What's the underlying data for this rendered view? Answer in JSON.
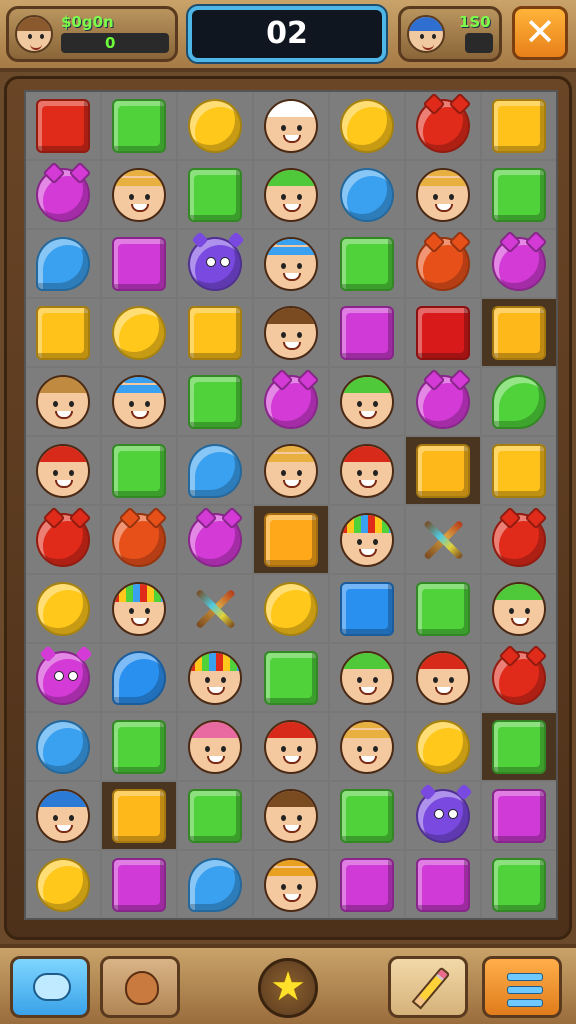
{
  "header": {
    "player1": {
      "label": "$0g0n",
      "score": "0"
    },
    "moves": "02",
    "player2": {
      "label": "1S0",
      "score": ""
    },
    "close_label": "✕"
  },
  "board": {
    "rows": [
      [
        [
          "square",
          "#e02a1a"
        ],
        [
          "square",
          "#4fd23a"
        ],
        [
          "circle",
          "#ffc81a"
        ],
        [
          "face",
          "#ffffff",
          "white-hair"
        ],
        [
          "circle",
          "#ffc81a"
        ],
        [
          "horned",
          "#e02a1a"
        ],
        [
          "square",
          "#ffc21a"
        ]
      ],
      [
        [
          "horned",
          "#d33ad6"
        ],
        [
          "face",
          "#e8b040",
          "straw-hat"
        ],
        [
          "square",
          "#4fd23a"
        ],
        [
          "face",
          "#4fc93a",
          "green-cap"
        ],
        [
          "circle",
          "#3aa0f0"
        ],
        [
          "face",
          "#e8b040",
          "straw-hat"
        ],
        [
          "square",
          "#4fd23a"
        ]
      ],
      [
        [
          "drop",
          "#3aa0f0"
        ],
        [
          "square",
          "#d03ad6"
        ],
        [
          "monster",
          "#7a4ae0"
        ],
        [
          "face",
          "#3aa0f0",
          "blue-hat"
        ],
        [
          "square",
          "#4fd23a"
        ],
        [
          "horned",
          "#e8501a"
        ],
        [
          "horned",
          "#d33ad6"
        ]
      ],
      [
        [
          "square",
          "#ffc21a"
        ],
        [
          "circle",
          "#ffc81a"
        ],
        [
          "square",
          "#ffc21a"
        ],
        [
          "face",
          "#7a4a20",
          "short-hair"
        ],
        [
          "square",
          "#d03ad6"
        ],
        [
          "square",
          "#d81a1a"
        ],
        [
          "square",
          "#ffb81a",
          "dark"
        ]
      ],
      [
        [
          "face",
          "#c08a40",
          "cap"
        ],
        [
          "face",
          "#3aa0f0",
          "blue-hat-bow"
        ],
        [
          "square",
          "#4fd23a"
        ],
        [
          "horned",
          "#d33ad6"
        ],
        [
          "face",
          "#4fc93a",
          "green-cap"
        ],
        [
          "horned",
          "#d33ad6"
        ],
        [
          "drop",
          "#4fd23a"
        ]
      ],
      [
        [
          "face",
          "#d82a1a",
          "red-cap"
        ],
        [
          "square",
          "#4fd23a"
        ],
        [
          "drop",
          "#3aa0f0"
        ],
        [
          "face",
          "#e8b040",
          "straw-hat"
        ],
        [
          "face",
          "#d82a1a",
          "red-cap"
        ],
        [
          "square",
          "#ffb81a",
          "dark"
        ],
        [
          "square",
          "#ffc21a"
        ]
      ],
      [
        [
          "horned",
          "#e02a1a"
        ],
        [
          "horned",
          "#e8501a"
        ],
        [
          "horned",
          "#d33ad6"
        ],
        [
          "square",
          "#ffa81a",
          "dark"
        ],
        [
          "face",
          "#e0c03a",
          "rainbow-hair"
        ],
        [
          "tools",
          "#b33a1a"
        ],
        [
          "horned",
          "#e02a1a"
        ]
      ],
      [
        [
          "circle",
          "#ffc81a"
        ],
        [
          "face",
          "#e0c03a",
          "rainbow-hair"
        ],
        [
          "tools",
          "#b33a1a"
        ],
        [
          "circle",
          "#ffc81a"
        ],
        [
          "square",
          "#2a90f0"
        ],
        [
          "square",
          "#4fd23a"
        ],
        [
          "face",
          "#4fc93a",
          "green-cap"
        ]
      ],
      [
        [
          "monster",
          "#d33ad6"
        ],
        [
          "drop",
          "#2a90f0"
        ],
        [
          "face",
          "#e0c03a",
          "rainbow-hair"
        ],
        [
          "square",
          "#4fd23a"
        ],
        [
          "face",
          "#4fc93a",
          "green-cap"
        ],
        [
          "face",
          "#d82a1a",
          "red-cap"
        ],
        [
          "horned",
          "#e02a1a"
        ]
      ],
      [
        [
          "circle",
          "#3aa0f0"
        ],
        [
          "square",
          "#4fd23a"
        ],
        [
          "face",
          "#e86aa0",
          "pink-hair"
        ],
        [
          "face",
          "#d82a1a",
          "red-pigtails"
        ],
        [
          "face",
          "#e8b040",
          "straw-hat"
        ],
        [
          "circle",
          "#ffc81a"
        ],
        [
          "square",
          "#4fd23a",
          "dark"
        ]
      ],
      [
        [
          "face",
          "#2a7ad6",
          "blue-cap"
        ],
        [
          "square",
          "#ffb81a",
          "dark"
        ],
        [
          "square",
          "#4fd23a"
        ],
        [
          "face",
          "#7a4a20",
          "short-hair"
        ],
        [
          "square",
          "#4fd23a"
        ],
        [
          "monster",
          "#7a4ae0"
        ],
        [
          "square",
          "#d03ad6"
        ]
      ],
      [
        [
          "circle",
          "#ffc81a"
        ],
        [
          "square",
          "#d03ad6"
        ],
        [
          "drop",
          "#3aa0f0"
        ],
        [
          "face",
          "#e8a020",
          "fox-hat"
        ],
        [
          "square",
          "#d03ad6"
        ],
        [
          "square",
          "#d03ad6"
        ],
        [
          "square",
          "#4fd23a"
        ]
      ]
    ]
  },
  "footer": {
    "cloud_icon": "cloud-icon",
    "pet_icon": "pet-icon",
    "star_icon": "★",
    "pencil_icon": "pencil-icon",
    "menu_icon": "menu-icon"
  }
}
